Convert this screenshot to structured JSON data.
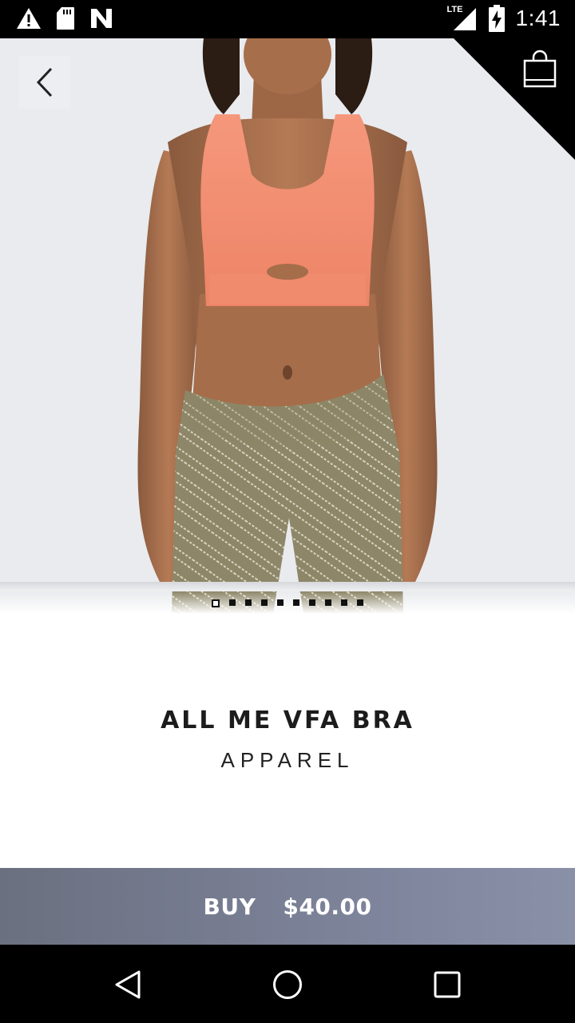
{
  "status_bar": {
    "time": "1:41",
    "network": "LTE",
    "icons": [
      "warning-icon",
      "sd-card-icon",
      "n-icon",
      "signal-icon",
      "battery-charging-icon"
    ]
  },
  "header": {
    "back_icon": "chevron-left-icon",
    "cart_icon": "shopping-bag-icon"
  },
  "carousel": {
    "image_icon": "product-photo",
    "page_count": 10,
    "active_index": 0
  },
  "product": {
    "name": "ALL ME VFA BRA",
    "category": "APPAREL"
  },
  "buy": {
    "label": "BUY",
    "price": "$40.00"
  },
  "nav": {
    "icons": [
      "back-triangle-icon",
      "home-circle-icon",
      "recents-square-icon"
    ]
  },
  "colors": {
    "buy_gradient_start": "#6b7080",
    "buy_gradient_end": "#8990a8",
    "bra_color": "#f28d72",
    "leggings_color": "#8d8668"
  }
}
